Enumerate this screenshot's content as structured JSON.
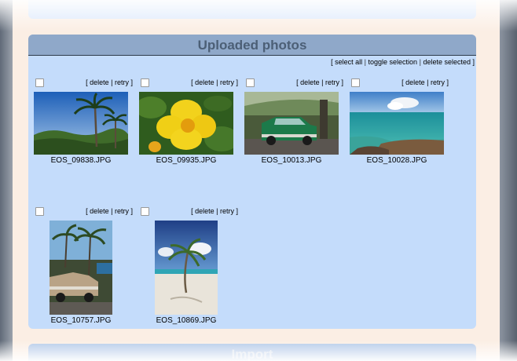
{
  "panel": {
    "title": "Uploaded photos",
    "actions": {
      "select_all": "select all",
      "toggle_selection": "toggle selection",
      "delete_selected": "delete selected"
    }
  },
  "photo_actions": {
    "delete": "delete",
    "retry": "retry"
  },
  "photos": [
    {
      "filename": "EOS_09838.JPG",
      "subject": "palm-trees-hills"
    },
    {
      "filename": "EOS_09935.JPG",
      "subject": "yellow-flower"
    },
    {
      "filename": "EOS_10013.JPG",
      "subject": "green-vintage-car"
    },
    {
      "filename": "EOS_10028.JPG",
      "subject": "turquoise-sea-rocks"
    },
    {
      "filename": "EOS_10757.JPG",
      "subject": "vintage-car-palms"
    },
    {
      "filename": "EOS_10869.JPG",
      "subject": "palm-on-beach"
    }
  ],
  "next_panel": {
    "title": "Import"
  }
}
